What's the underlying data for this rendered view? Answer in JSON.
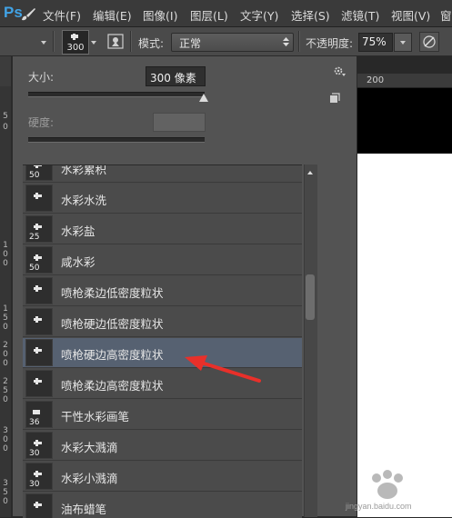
{
  "app": {
    "logo_text": "Ps"
  },
  "menubar": {
    "items": [
      "文件(F)",
      "编辑(E)",
      "图像(I)",
      "图层(L)",
      "文字(Y)",
      "选择(S)",
      "滤镜(T)",
      "视图(V)",
      "窗"
    ]
  },
  "options_bar": {
    "brush_size_preview": "300",
    "mode_label": "模式:",
    "mode_value": "正常",
    "opacity_label": "不透明度:",
    "opacity_value": "75%"
  },
  "brush_panel": {
    "size_label": "大小:",
    "size_value": "300 像素",
    "size_slider_fraction": 1.0,
    "hardness_label": "硬度:",
    "hardness_value": "",
    "brushes": [
      {
        "label": "水彩累积",
        "size": "50",
        "selected": false
      },
      {
        "label": "水彩水洗",
        "size": "",
        "selected": false
      },
      {
        "label": "水彩盐",
        "size": "25",
        "selected": false
      },
      {
        "label": "咸水彩",
        "size": "50",
        "selected": false
      },
      {
        "label": "喷枪柔边低密度粒状",
        "size": "",
        "selected": false
      },
      {
        "label": "喷枪硬边低密度粒状",
        "size": "",
        "selected": false
      },
      {
        "label": "喷枪硬边高密度粒状",
        "size": "",
        "selected": true
      },
      {
        "label": "喷枪柔边高密度粒状",
        "size": "",
        "selected": false
      },
      {
        "label": "干性水彩画笔",
        "size": "36",
        "selected": false
      },
      {
        "label": "水彩大溅滴",
        "size": "30",
        "selected": false
      },
      {
        "label": "水彩小溅滴",
        "size": "30",
        "selected": false
      },
      {
        "label": "油布蜡笔",
        "size": "",
        "selected": false
      }
    ]
  },
  "ruler": {
    "horizontal_label": "200",
    "vertical_labels": [
      "5",
      "0",
      "1\n0\n0",
      "1\n5\n0",
      "2\n0\n0",
      "2\n5\n0",
      "3\n0\n0",
      "3\n5\n0"
    ]
  },
  "colors": {
    "selected_row": "#566171",
    "annotation_arrow": "#e8302a",
    "logo": "#41a3e6"
  },
  "watermark": {
    "text": "jingyan.baidu.com"
  }
}
